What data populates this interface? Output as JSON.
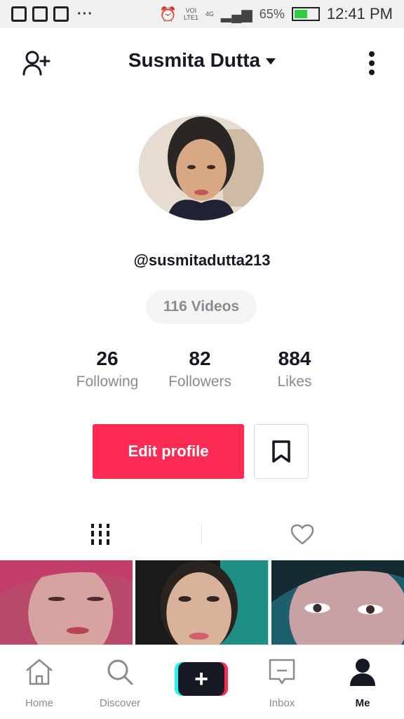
{
  "status_bar": {
    "network_top": "VOI",
    "network_bottom": "LTE1",
    "network_gen": "4G",
    "battery": "65%",
    "time": "12:41 PM"
  },
  "header": {
    "title": "Susmita Dutta"
  },
  "profile": {
    "username": "@susmitadutta213",
    "videos_pill": "116 Videos",
    "stats": [
      {
        "value": "26",
        "label": "Following"
      },
      {
        "value": "82",
        "label": "Followers"
      },
      {
        "value": "884",
        "label": "Likes"
      }
    ],
    "edit_button": "Edit profile"
  },
  "bottom_nav": {
    "items": [
      {
        "label": "Home",
        "icon": "home-icon"
      },
      {
        "label": "Discover",
        "icon": "search-icon"
      },
      {
        "label": "+",
        "icon": "create-icon"
      },
      {
        "label": "Inbox",
        "icon": "inbox-icon"
      },
      {
        "label": "Me",
        "icon": "profile-icon"
      }
    ]
  },
  "colors": {
    "accent": "#fe2c55",
    "cyan": "#25f4ee",
    "text": "#161823",
    "muted": "#8a8b91"
  }
}
